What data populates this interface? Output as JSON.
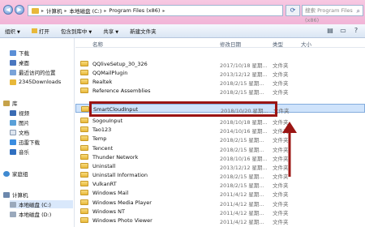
{
  "address": {
    "segments": [
      "计算机",
      "本地磁盘 (C:)",
      "Program Files (x86)"
    ]
  },
  "search": {
    "placeholder": "搜索 Program Files (x86)"
  },
  "toolbar": {
    "organize": "组织",
    "open": "打开",
    "include": "包含到库中",
    "share": "共享",
    "new_folder": "新建文件夹"
  },
  "columns": {
    "name": "名称",
    "date": "修改日期",
    "type": "类型",
    "size": "大小"
  },
  "sidebar": {
    "items": [
      "下载",
      "桌面",
      "最近访问的位置",
      "2345Downloads",
      "库",
      "视频",
      "图片",
      "文档",
      "迅雷下载",
      "音乐",
      "家庭组",
      "计算机",
      "本地磁盘 (C:)",
      "本地磁盘 (D:)"
    ]
  },
  "files": [
    {
      "name": "QQliveSetup_30_326",
      "date": "2017/10/18 星期...",
      "type": "文件夹"
    },
    {
      "name": "QQMailPlugin",
      "date": "2013/12/12 星期...",
      "type": "文件夹"
    },
    {
      "name": "Realtek",
      "date": "2018/2/15 星期...",
      "type": "文件夹"
    },
    {
      "name": "Reference Assemblies",
      "date": "2018/2/15 星期...",
      "type": "文件夹"
    },
    {
      "name": "SmartCloudInput",
      "date": "2018/10/20 星期...",
      "type": "文件夹"
    },
    {
      "name": "SogouInput",
      "date": "2018/10/18 星期...",
      "type": "文件夹"
    },
    {
      "name": "Tao123",
      "date": "2014/10/16 星期...",
      "type": "文件夹"
    },
    {
      "name": "Temp",
      "date": "2018/2/15 星期...",
      "type": "文件夹"
    },
    {
      "name": "Tencent",
      "date": "2018/2/15 星期...",
      "type": "文件夹"
    },
    {
      "name": "Thunder Network",
      "date": "2018/10/16 星期...",
      "type": "文件夹"
    },
    {
      "name": "Uninstall",
      "date": "2013/12/12 星期...",
      "type": "文件夹"
    },
    {
      "name": "Uninstall Information",
      "date": "2018/2/15 星期...",
      "type": "文件夹"
    },
    {
      "name": "VulkanRT",
      "date": "2018/2/15 星期...",
      "type": "文件夹"
    },
    {
      "name": "Windows Mail",
      "date": "2011/4/12 星期...",
      "type": "文件夹"
    },
    {
      "name": "Windows Media Player",
      "date": "2011/4/12 星期...",
      "type": "文件夹"
    },
    {
      "name": "Windows NT",
      "date": "2011/4/12 星期...",
      "type": "文件夹"
    },
    {
      "name": "Windows Photo Viewer",
      "date": "2011/4/12 星期...",
      "type": "文件夹"
    }
  ],
  "colors": {
    "highlight": "#9b1513",
    "accent": "#3b7ad0"
  }
}
